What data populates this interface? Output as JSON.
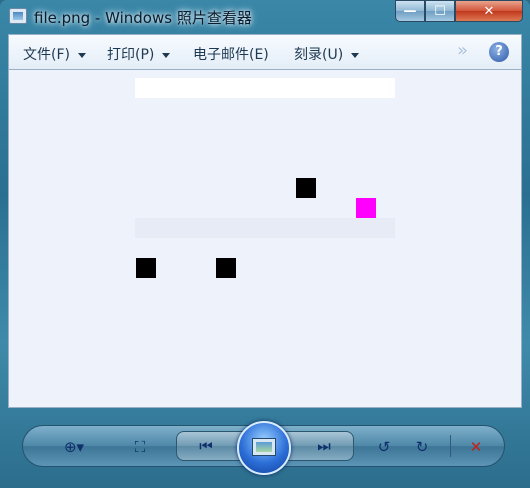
{
  "window": {
    "title": "file.png - Windows 照片查看器"
  },
  "caption_buttons": {
    "minimize": "—",
    "maximize": "☐",
    "close": "✕"
  },
  "menubar": {
    "items": [
      {
        "label": "文件(F)",
        "has_dropdown": true
      },
      {
        "label": "打印(P)",
        "has_dropdown": true
      },
      {
        "label": "电子邮件(E)",
        "has_dropdown": false
      },
      {
        "label": "刻录(U)",
        "has_dropdown": true
      }
    ],
    "overflow_glyph": "»",
    "help_glyph": "?"
  },
  "image_pixels": [
    {
      "name": "black-pixel-1",
      "color": "#000000"
    },
    {
      "name": "magenta-pixel",
      "color": "#ff00ff"
    },
    {
      "name": "black-pixel-2",
      "color": "#000000"
    },
    {
      "name": "black-pixel-3",
      "color": "#000000"
    }
  ],
  "toolbar": {
    "zoom_glyph": "⊕▾",
    "actual_size_glyph": "⛶",
    "prev_glyph": "⏮",
    "next_glyph": "⏭",
    "rotate_ccw_glyph": "↺",
    "rotate_cw_glyph": "↻",
    "delete_glyph": "✕"
  }
}
